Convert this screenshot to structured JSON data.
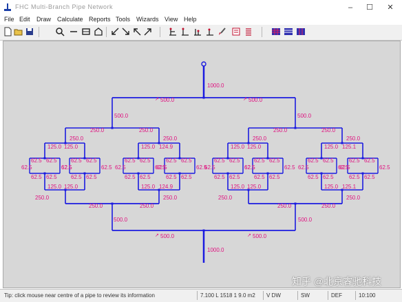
{
  "window": {
    "title": "FHC Multi-Branch Pipe Network",
    "controls": [
      "–",
      "☐",
      "✕"
    ]
  },
  "menu": [
    "File",
    "Edit",
    "Draw",
    "Calculate",
    "Reports",
    "Tools",
    "Wizards",
    "View",
    "Help"
  ],
  "toolbar": {
    "groups": [
      [
        "new",
        "open",
        "save"
      ],
      [
        "zoom",
        "line",
        "rect",
        "node"
      ],
      [
        "arrow-down-left",
        "arrow-down-right",
        "arrow-up-left",
        "arrow-up-right"
      ],
      [
        "branch-1",
        "branch-2",
        "branch-3",
        "branch-4",
        "brush",
        "report",
        "list"
      ],
      [
        "grid-1",
        "grid-2",
        "grid-3"
      ]
    ]
  },
  "network": {
    "line_color": "#1a1ae0",
    "label_color": "#e0107f",
    "node_color": "#1a1ae0",
    "source_flow": "1000.0",
    "outlet_flow": "1000.0",
    "level1": [
      "500.0",
      "500.0"
    ],
    "level1_vertical": [
      "500.0",
      "500.0"
    ],
    "level2": [
      "250.0",
      "250.0",
      "250.0",
      "250.0"
    ],
    "level2_right": [
      "250.0",
      "250.0",
      "250.0",
      "250.0"
    ],
    "level3": [
      "125.0",
      "125.0",
      "125.0",
      "124.9",
      "125.0",
      "125.0",
      "125.0",
      "125.1"
    ],
    "level4": [
      "62.5",
      "62.5",
      "62.5",
      "62.5",
      "62.5",
      "62.5",
      "62.5",
      "62.5"
    ],
    "level4_side": [
      "62.5",
      "62.5",
      "62.5",
      "62.5",
      "62.5",
      "62.5",
      "62.5",
      "62.5"
    ],
    "level4_bottom": [
      "62.5",
      "62.5",
      "62.5",
      "62.5",
      "62.5",
      "62.5",
      "62.5",
      "62.5"
    ],
    "level3_bottom": [
      "125.0",
      "125.0",
      "125.0",
      "124.9",
      "125.0",
      "125.0",
      "125.0",
      "125.1"
    ],
    "level2_bottom": [
      "250.0",
      "250.0",
      "250.0",
      "250.0"
    ],
    "level1_bottom": [
      "500.0",
      "500.0"
    ],
    "level1_bottom_vertical": [
      "500.0",
      "500.0"
    ]
  },
  "status": {
    "hint": "Tip: click mouse near centre of a pipe to review its information",
    "coords": "7.100 L 1518 1 9.0 m2",
    "mode": "V DW",
    "sw": "SW",
    "unit": "DEF",
    "time": "10:100"
  },
  "watermark": "知乎 @北京睿驰科技"
}
